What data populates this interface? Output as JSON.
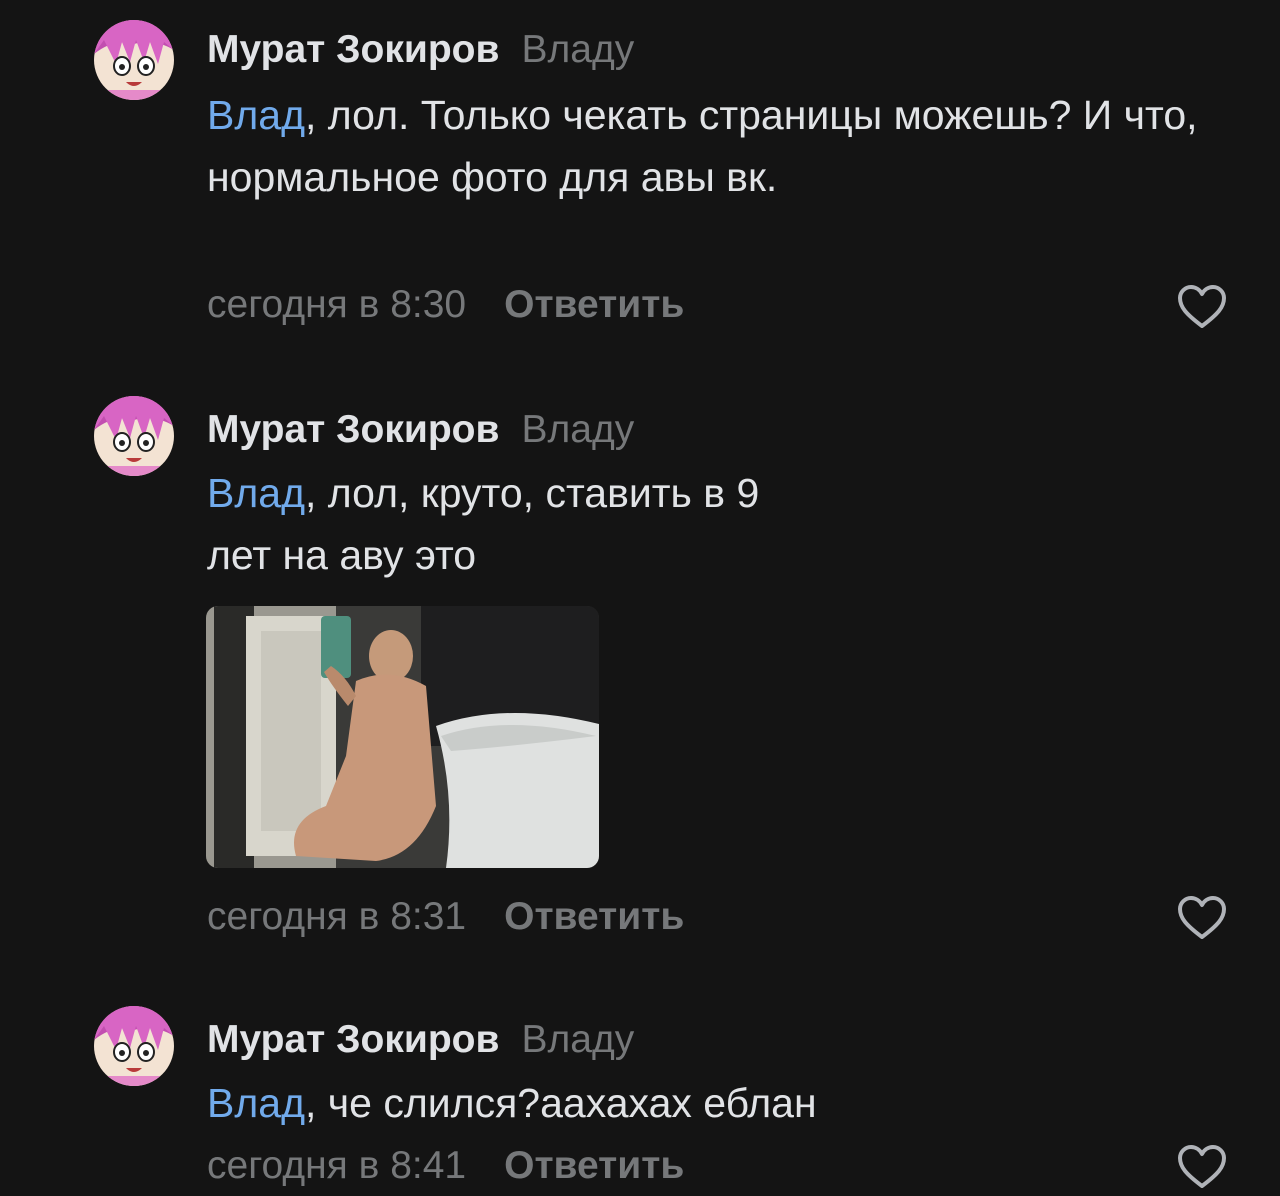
{
  "comments": [
    {
      "author": "Мурат Зокиров",
      "reply_to": "Владу",
      "mention": "Влад",
      "text": ", лол. Только чекать страницы можешь? И что, нормальное фото для авы вк.",
      "time": "сегодня в 8:30",
      "reply_label": "Ответить"
    },
    {
      "author": "Мурат Зокиров",
      "reply_to": "Владу",
      "mention": "Влад",
      "text": ", лол, круто, ставить в 9 лет на аву это",
      "time": "сегодня в 8:31",
      "reply_label": "Ответить"
    },
    {
      "author": "Мурат Зокиров",
      "reply_to": "Владу",
      "mention": "Влад",
      "text": ", че слился?аахахах еблан",
      "time": "сегодня в 8:41",
      "reply_label": "Ответить"
    }
  ],
  "icons": {
    "like": "heart-outline-icon",
    "avatar": "anime-avatar"
  },
  "colors": {
    "background": "#141414",
    "text": "#e1e3e6",
    "secondary": "#76787a",
    "link": "#71aaeb"
  }
}
